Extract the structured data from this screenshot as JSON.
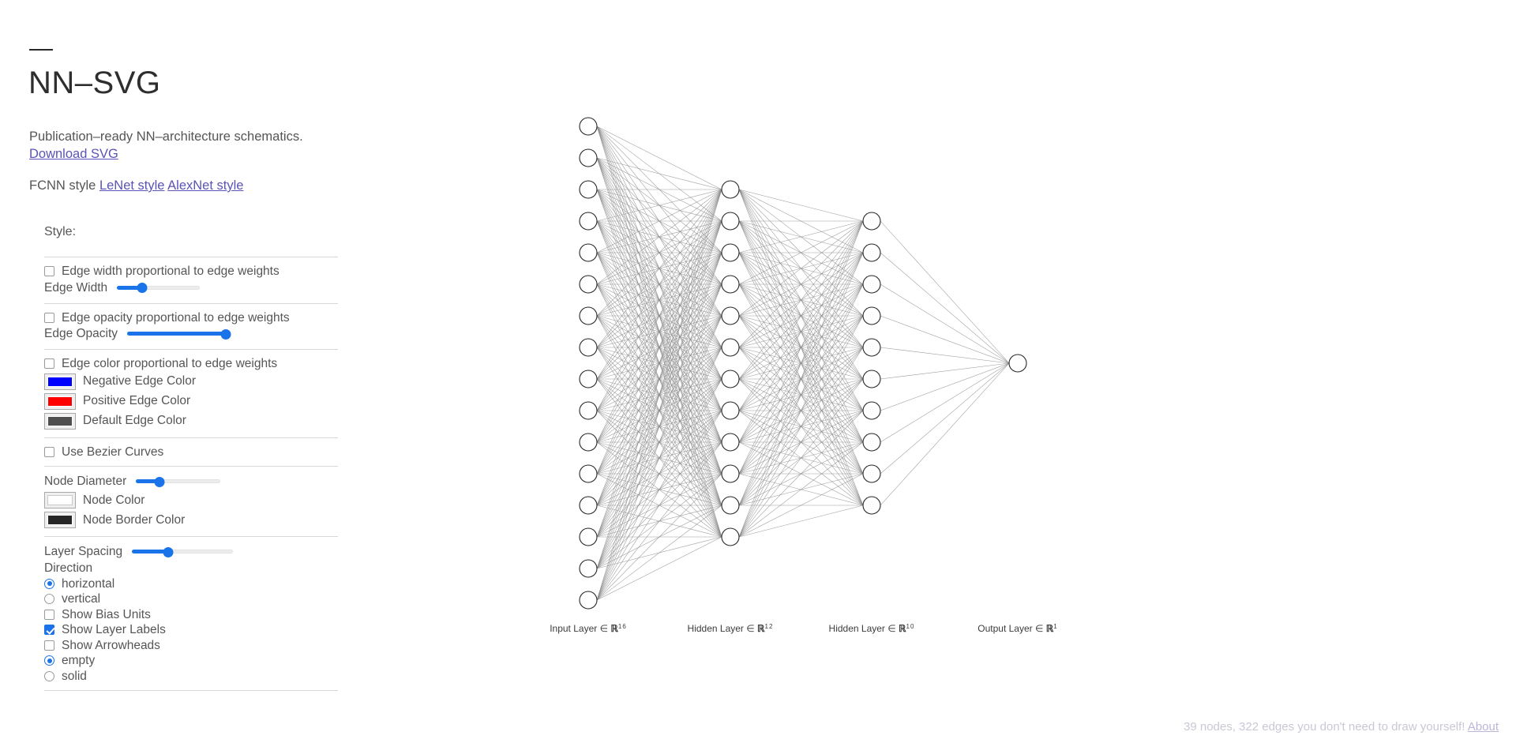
{
  "header": {
    "title": "NN–SVG",
    "tagline": "Publication–ready NN–architecture schematics.",
    "download_label": "Download SVG",
    "style_prefix": "FCNN style",
    "style_links": [
      {
        "label": "LeNet style",
        "active": false
      },
      {
        "label": "AlexNet style",
        "active": false
      }
    ]
  },
  "controls": {
    "style_heading": "Style:",
    "edge_width_checkbox": {
      "label": "Edge width proportional to edge weights",
      "checked": false
    },
    "edge_width_slider": {
      "label": "Edge Width",
      "percent": 30
    },
    "edge_opacity_checkbox": {
      "label": "Edge opacity proportional to edge weights",
      "checked": false
    },
    "edge_opacity_slider": {
      "label": "Edge Opacity",
      "percent": 100
    },
    "edge_color_checkbox": {
      "label": "Edge color proportional to edge weights",
      "checked": false
    },
    "negative_edge_color": {
      "label": "Negative Edge Color",
      "color": "#0000ff"
    },
    "positive_edge_color": {
      "label": "Positive Edge Color",
      "color": "#ff0000"
    },
    "default_edge_color": {
      "label": "Default Edge Color",
      "color": "#505050"
    },
    "bezier_checkbox": {
      "label": "Use Bezier Curves",
      "checked": false
    },
    "node_diameter_slider": {
      "label": "Node Diameter",
      "percent": 28
    },
    "node_color": {
      "label": "Node Color",
      "color": "#ffffff"
    },
    "node_border_color": {
      "label": "Node Border Color",
      "color": "#262626"
    },
    "layer_spacing_slider": {
      "label": "Layer Spacing",
      "percent": 36
    },
    "direction_label": "Direction",
    "direction_horizontal": {
      "label": "horizontal",
      "checked": true
    },
    "direction_vertical": {
      "label": "vertical",
      "checked": false
    },
    "show_bias_units": {
      "label": "Show Bias Units",
      "checked": false
    },
    "show_layer_labels": {
      "label": "Show Layer Labels",
      "checked": true
    },
    "show_arrowheads": {
      "label": "Show Arrowheads",
      "checked": false
    },
    "fill_empty": {
      "label": "empty",
      "checked": true
    },
    "fill_solid": {
      "label": "solid",
      "checked": false
    }
  },
  "diagram": {
    "layers": [
      {
        "name": "Input Layer",
        "base": "ℝ",
        "exponent": "16",
        "nodes": 16
      },
      {
        "name": "Hidden Layer",
        "base": "ℝ",
        "exponent": "12",
        "nodes": 12
      },
      {
        "name": "Hidden Layer",
        "base": "ℝ",
        "exponent": "10",
        "nodes": 10
      },
      {
        "name": "Output Layer",
        "base": "ℝ",
        "exponent": "1",
        "nodes": 1
      }
    ],
    "membership_symbol": "∈",
    "node_fill": "#ffffff",
    "node_stroke": "#262626",
    "edge_color": "#8a8a8a"
  },
  "footer": {
    "status": "39 nodes, 322 edges you don't need to draw yourself!",
    "about_label": "About"
  },
  "chart_data": {
    "type": "diagram",
    "title": "Fully connected neural network (FCNN) schematic",
    "layer_sizes": [
      16,
      12,
      10,
      1
    ],
    "layer_names": [
      "Input Layer",
      "Hidden Layer",
      "Hidden Layer",
      "Output Layer"
    ],
    "total_nodes": 39,
    "total_edges": 322,
    "orientation": "horizontal"
  }
}
